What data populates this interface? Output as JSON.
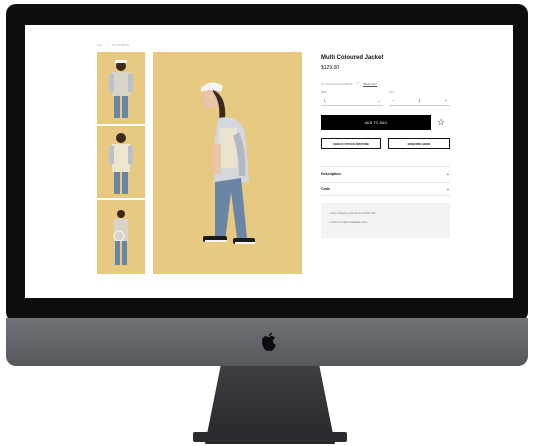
{
  "breadcrumb": [
    "ALL",
    "/",
    "CLOTHING"
  ],
  "product": {
    "title": "Multi Coloured Jacket",
    "price": "$129.00"
  },
  "afterpay": {
    "text": "Or 4 payments from $32.25",
    "link": "What's this?"
  },
  "size": {
    "label": "SIZE",
    "value": "L"
  },
  "qty": {
    "label": "QTY",
    "minus": "−",
    "value": "1",
    "plus": "+"
  },
  "buttons": {
    "add_to_bag": "ADD TO BAG",
    "check_stock": "CHECK STOCK INSTORE",
    "enquire": "ENQUIRE HERE"
  },
  "accordions": [
    {
      "label": "Description"
    },
    {
      "label": "Code"
    }
  ],
  "info_lines": [
    "Free shipping and returns within NZ.",
    "Click & Collect Available Now."
  ],
  "icons": {
    "wishlist": "star-icon",
    "chevron": "chevron-down-icon",
    "afterpay": "afterpay-icon",
    "brand": "apple-logo"
  },
  "colors": {
    "photo_bg": "#e8c981",
    "button_bg": "#000000",
    "bezel": "#0d0d0d",
    "chin": "#6f7277"
  }
}
